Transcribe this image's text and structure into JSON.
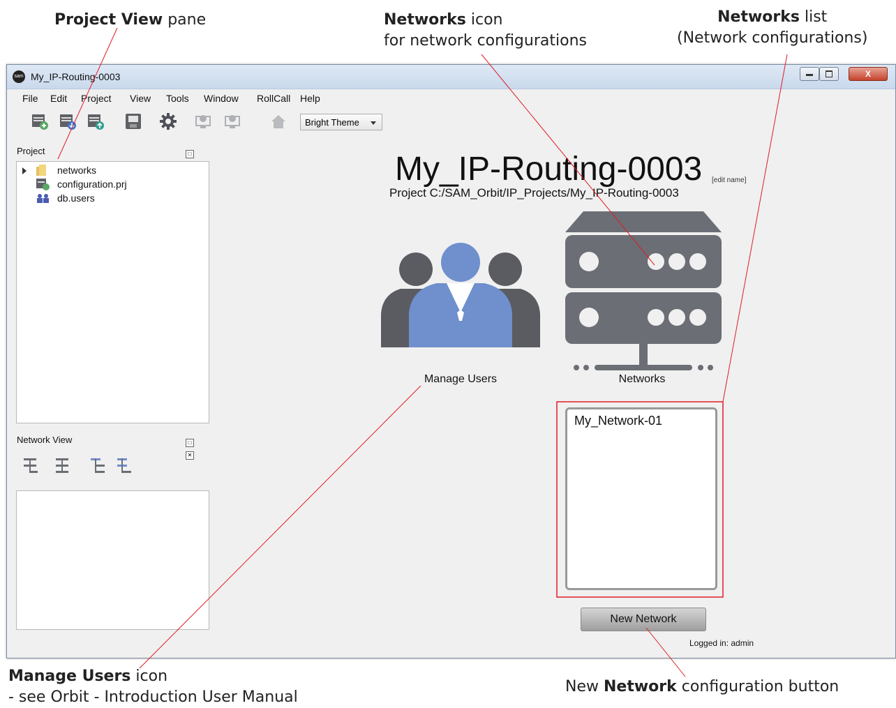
{
  "callouts": {
    "project_view_bold": "Project View",
    "project_view_rest": " pane",
    "networks_icon_bold": "Networks",
    "networks_icon_rest": " icon",
    "networks_icon_line2": "for network configurations",
    "networks_list_bold": "Networks",
    "networks_list_rest": " list",
    "networks_list_line2": "(Network configurations)",
    "manage_users_bold": "Manage Users",
    "manage_users_rest": " icon",
    "manage_users_line2": "- see Orbit - Introduction User Manual",
    "new_network_pre": "New ",
    "new_network_bold": "Network",
    "new_network_rest": " configuration button"
  },
  "window": {
    "app_icon": "sam",
    "title": "My_IP-Routing-0003",
    "close_label": "X"
  },
  "menubar": [
    "File",
    "Edit",
    "Project",
    "View",
    "Tools",
    "Window",
    "RollCall",
    "Help"
  ],
  "toolbar": {
    "icons": [
      "new-project-icon",
      "open-project-icon",
      "upload-project-icon",
      "save-icon",
      "settings-gear-icon",
      "monitor-export-icon",
      "monitor-import-icon",
      "home-icon"
    ],
    "theme_value": "Bright Theme"
  },
  "project_panel": {
    "header": "Project",
    "items": [
      {
        "label": "networks",
        "icon": "folder-icon"
      },
      {
        "label": "configuration.prj",
        "icon": "configuration-file-icon"
      },
      {
        "label": "db.users",
        "icon": "users-db-icon"
      }
    ]
  },
  "network_view_panel": {
    "header": "Network View",
    "icons": [
      "tree-expand-icon",
      "tree-collapse-icon",
      "tree-expand-all-icon",
      "tree-collapse-all-icon"
    ]
  },
  "main": {
    "project_title": "My_IP-Routing-0003",
    "edit_name": "[edit name]",
    "project_path": "Project C:/SAM_Orbit/IP_Projects/My_IP-Routing-0003",
    "manage_users_label": "Manage Users",
    "networks_label": "Networks",
    "networks_list": [
      "My_Network-01"
    ],
    "new_network_label": "New Network",
    "status": "Logged in: admin"
  },
  "colors": {
    "accent_red": "#e01b24",
    "users_blue": "#6f8fcd",
    "icon_gray": "#6b6e75"
  }
}
